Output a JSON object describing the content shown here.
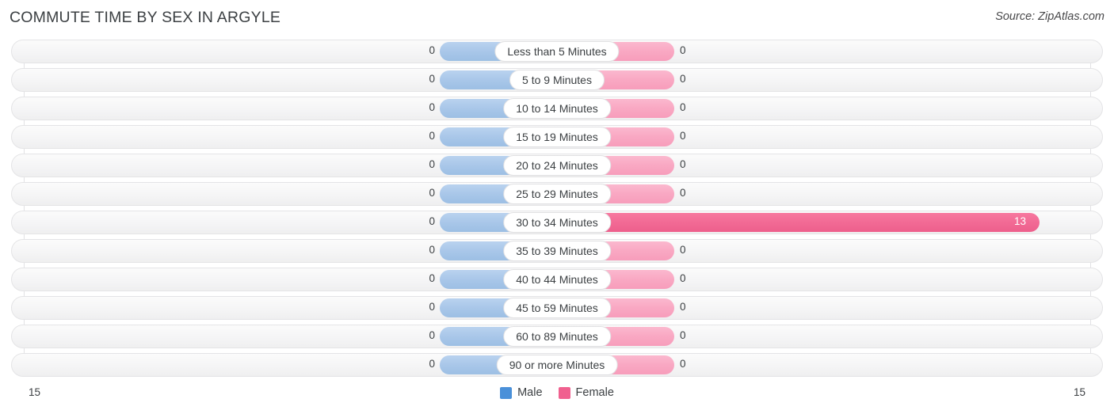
{
  "header": {
    "title": "COMMUTE TIME BY SEX IN ARGYLE",
    "source": "Source: ZipAtlas.com"
  },
  "legend": {
    "male_label": "Male",
    "female_label": "Female",
    "male_color": "#4a90d9",
    "female_color": "#f0608f"
  },
  "axis": {
    "left_label": "15",
    "right_label": "15"
  },
  "chart_data": {
    "type": "bar",
    "orientation": "horizontal-diverging",
    "title": "COMMUTE TIME BY SEX IN ARGYLE",
    "xlabel": "",
    "ylabel": "",
    "xlim": [
      15,
      15
    ],
    "grid": true,
    "legend_position": "bottom-center",
    "categories": [
      "Less than 5 Minutes",
      "5 to 9 Minutes",
      "10 to 14 Minutes",
      "15 to 19 Minutes",
      "20 to 24 Minutes",
      "25 to 29 Minutes",
      "30 to 34 Minutes",
      "35 to 39 Minutes",
      "40 to 44 Minutes",
      "45 to 59 Minutes",
      "60 to 89 Minutes",
      "90 or more Minutes"
    ],
    "series": [
      {
        "name": "Male",
        "color": "#a9c7e9",
        "values": [
          0,
          0,
          0,
          0,
          0,
          0,
          0,
          0,
          0,
          0,
          0,
          0
        ]
      },
      {
        "name": "Female",
        "color": "#f9a8c3",
        "values": [
          0,
          0,
          0,
          0,
          0,
          0,
          13,
          0,
          0,
          0,
          0,
          0
        ]
      }
    ]
  },
  "rows": [
    {
      "label": "Less than 5 Minutes",
      "male": "0",
      "female": "0"
    },
    {
      "label": "5 to 9 Minutes",
      "male": "0",
      "female": "0"
    },
    {
      "label": "10 to 14 Minutes",
      "male": "0",
      "female": "0"
    },
    {
      "label": "15 to 19 Minutes",
      "male": "0",
      "female": "0"
    },
    {
      "label": "20 to 24 Minutes",
      "male": "0",
      "female": "0"
    },
    {
      "label": "25 to 29 Minutes",
      "male": "0",
      "female": "0"
    },
    {
      "label": "30 to 34 Minutes",
      "male": "0",
      "female": "13"
    },
    {
      "label": "35 to 39 Minutes",
      "male": "0",
      "female": "0"
    },
    {
      "label": "40 to 44 Minutes",
      "male": "0",
      "female": "0"
    },
    {
      "label": "45 to 59 Minutes",
      "male": "0",
      "female": "0"
    },
    {
      "label": "60 to 89 Minutes",
      "male": "0",
      "female": "0"
    },
    {
      "label": "90 or more Minutes",
      "male": "0",
      "female": "0"
    }
  ]
}
